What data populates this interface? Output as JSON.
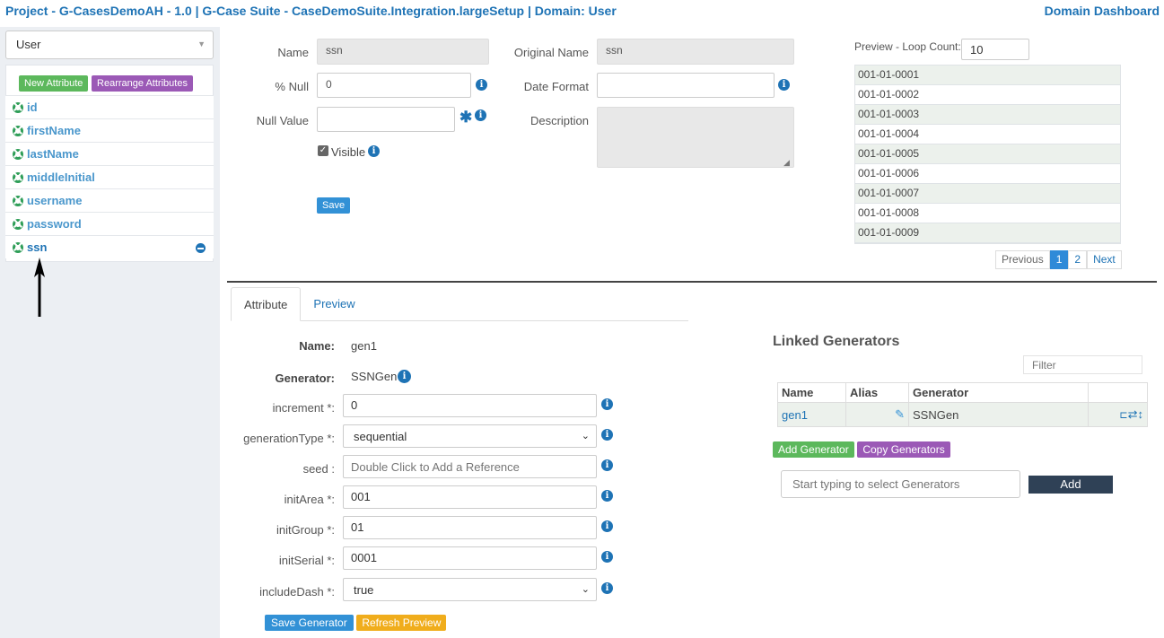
{
  "header": {
    "title": "Project - G-CasesDemoAH - 1.0 | G-Case Suite - CaseDemoSuite.Integration.largeSetup | Domain: User",
    "dashboard_link": "Domain Dashboard"
  },
  "sidebar": {
    "entity_select": "User",
    "new_attribute": "New Attribute",
    "rearrange_attributes": "Rearrange Attributes",
    "attributes": [
      {
        "label": "id"
      },
      {
        "label": "firstName"
      },
      {
        "label": "lastName"
      },
      {
        "label": "middleInitial"
      },
      {
        "label": "username"
      },
      {
        "label": "password"
      },
      {
        "label": "ssn"
      }
    ]
  },
  "attribute_form": {
    "name_label": "Name",
    "name_value": "ssn",
    "original_name_label": "Original Name",
    "original_name_value": "ssn",
    "pct_null_label": "% Null",
    "pct_null_value": "0",
    "date_format_label": "Date Format",
    "date_format_value": "",
    "null_value_label": "Null Value",
    "null_value_value": "",
    "description_label": "Description",
    "description_value": "",
    "visible_label": "Visible",
    "save_label": "Save"
  },
  "preview": {
    "loop_count_label": "Preview - Loop Count:",
    "loop_count_value": "10",
    "rows": [
      "001-01-0001",
      "001-01-0002",
      "001-01-0003",
      "001-01-0004",
      "001-01-0005",
      "001-01-0006",
      "001-01-0007",
      "001-01-0008",
      "001-01-0009"
    ],
    "pager": {
      "previous": "Previous",
      "page1": "1",
      "page2": "2",
      "next": "Next"
    }
  },
  "tabs": {
    "attribute": "Attribute",
    "preview": "Preview"
  },
  "generator_form": {
    "name_label": "Name:",
    "name_value": "gen1",
    "generator_label": "Generator:",
    "generator_value": "SSNGen",
    "fields": [
      {
        "label": "increment *:",
        "value": "0",
        "type": "input"
      },
      {
        "label": "generationType *:",
        "value": "sequential",
        "type": "select"
      },
      {
        "label": "seed :",
        "value": "",
        "placeholder": "Double Click to Add a Reference",
        "type": "input"
      },
      {
        "label": "initArea *:",
        "value": "001",
        "type": "input"
      },
      {
        "label": "initGroup *:",
        "value": "01",
        "type": "input"
      },
      {
        "label": "initSerial *:",
        "value": "0001",
        "type": "input"
      },
      {
        "label": "includeDash *:",
        "value": "true",
        "type": "select"
      }
    ],
    "save_generator": "Save Generator",
    "refresh_preview": "Refresh Preview"
  },
  "linked_generators": {
    "title": "Linked Generators",
    "filter_placeholder": "Filter",
    "columns": [
      "Name",
      "Alias",
      "Generator"
    ],
    "rows": [
      {
        "name": "gen1",
        "alias": "",
        "generator": "SSNGen"
      }
    ],
    "add_generator": "Add Generator",
    "copy_generators": "Copy Generators",
    "typeahead_placeholder": "Start typing to select Generators",
    "add_label": "Add"
  }
}
